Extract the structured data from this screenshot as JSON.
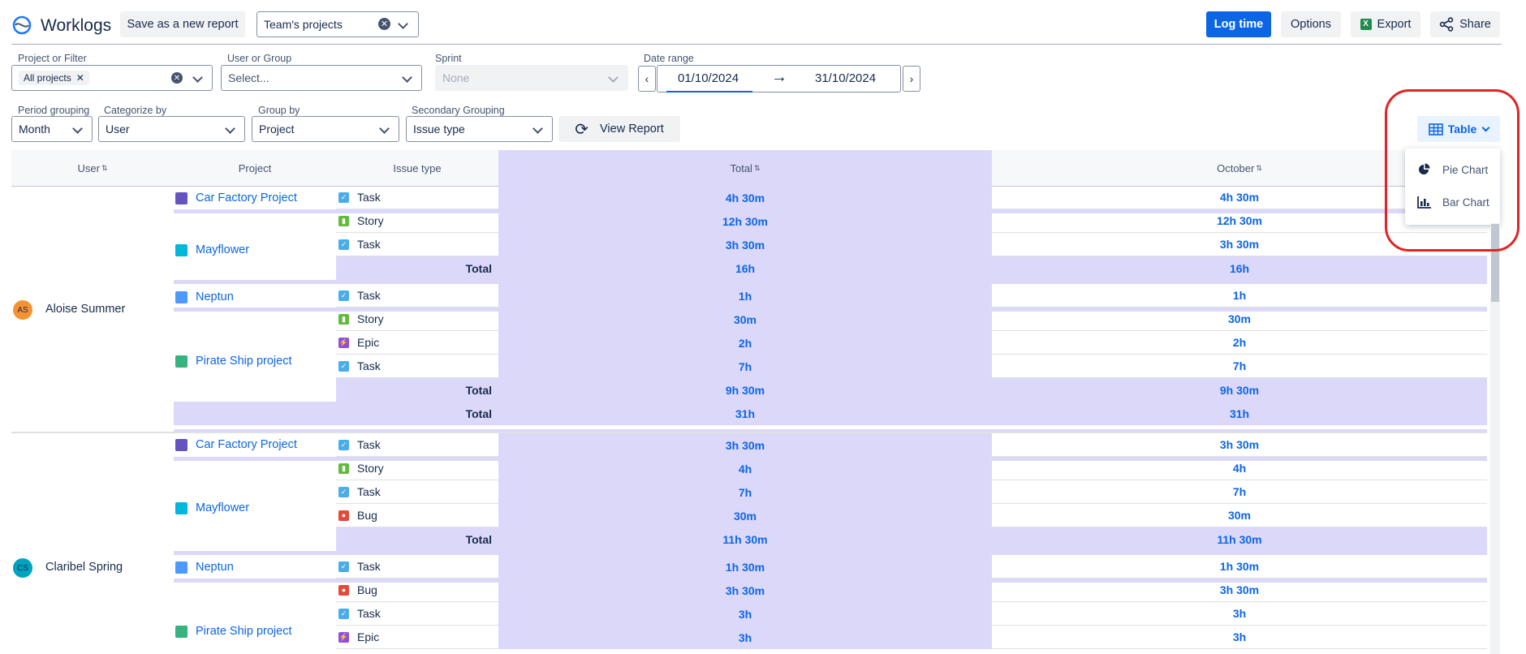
{
  "header": {
    "title": "Worklogs",
    "save_label": "Save as a new report",
    "report_value": "Team's projects",
    "log_time_label": "Log time",
    "options_label": "Options",
    "export_label": "Export",
    "share_label": "Share"
  },
  "filters": {
    "project_label": "Project or Filter",
    "project_chip": "All projects",
    "user_label": "User or Group",
    "user_placeholder": "Select...",
    "sprint_label": "Sprint",
    "sprint_value": "None",
    "date_label": "Date range",
    "date_from": "01/10/2024",
    "date_to": "31/10/2024",
    "period_label": "Period grouping",
    "period_value": "Month",
    "categorize_label": "Categorize by",
    "categorize_value": "User",
    "group_label": "Group by",
    "group_value": "Project",
    "secondary_label": "Secondary Grouping",
    "secondary_value": "Issue type",
    "view_report_label": "View Report"
  },
  "view_menu": {
    "current": "Table",
    "items": [
      "Pie Chart",
      "Bar Chart"
    ]
  },
  "table": {
    "columns": [
      "User",
      "Project",
      "Issue type",
      "Total",
      "October"
    ],
    "total_label": "Total",
    "users": [
      {
        "initials": "AS",
        "name": "Aloise Summer",
        "color": "#f79232"
      },
      {
        "initials": "CS",
        "name": "Claribel Spring",
        "color": "#00a3bf"
      }
    ],
    "rows": [
      {
        "project": "Car Factory Project",
        "type": "Task",
        "total": "4h 30m",
        "october": "4h 30m"
      },
      {
        "project": "Mayflower",
        "type": "Story",
        "total": "12h 30m",
        "october": "12h 30m"
      },
      {
        "type": "Task",
        "total": "3h 30m",
        "october": "3h 30m"
      },
      {
        "sub": "Total",
        "total": "16h",
        "october": "16h"
      },
      {
        "project": "Neptun",
        "type": "Task",
        "total": "1h",
        "october": "1h"
      },
      {
        "type": "Story",
        "total": "30m",
        "october": "30m"
      },
      {
        "type": "Epic",
        "total": "2h",
        "october": "2h"
      },
      {
        "project": "Pirate Ship project",
        "type": "Task",
        "total": "7h",
        "october": "7h"
      },
      {
        "sub": "Total",
        "total": "9h 30m",
        "october": "9h 30m"
      },
      {
        "sub": "Total",
        "total": "31h",
        "october": "31h"
      },
      {
        "project": "Car Factory Project",
        "type": "Task",
        "total": "3h 30m",
        "october": "3h 30m"
      },
      {
        "type": "Story",
        "total": "4h",
        "october": "4h"
      },
      {
        "project": "Mayflower",
        "type": "Task",
        "total": "7h",
        "october": "7h"
      },
      {
        "type": "Bug",
        "total": "30m",
        "october": "30m"
      },
      {
        "sub": "Total",
        "total": "11h 30m",
        "october": "11h 30m"
      },
      {
        "project": "Neptun",
        "type": "Task",
        "total": "1h 30m",
        "october": "1h 30m"
      },
      {
        "type": "Bug",
        "total": "3h 30m",
        "october": "3h 30m"
      },
      {
        "type": "Task",
        "total": "3h",
        "october": "3h"
      },
      {
        "project": "Pirate Ship project",
        "type": "Epic",
        "total": "3h",
        "october": "3h"
      }
    ]
  }
}
